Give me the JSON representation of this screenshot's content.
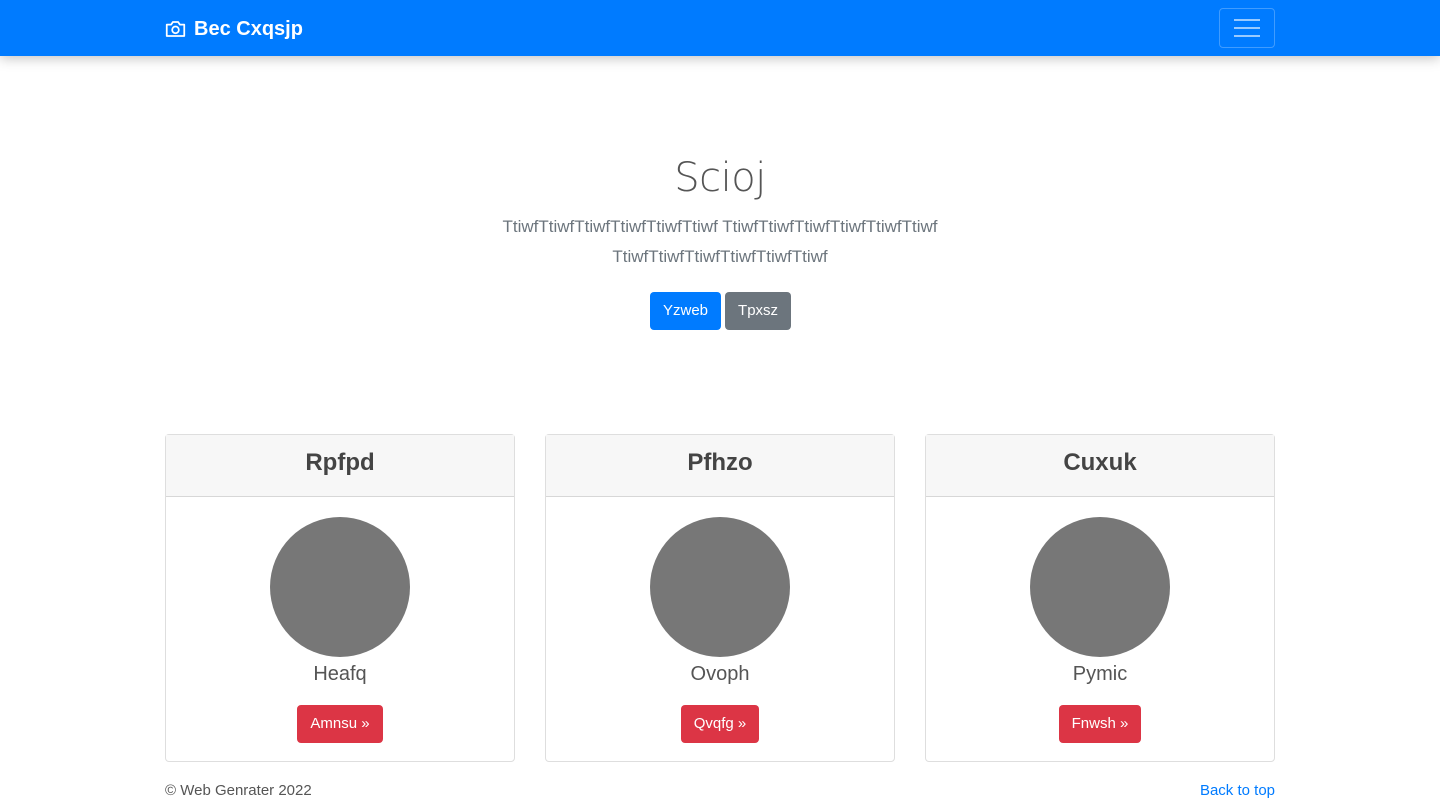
{
  "navbar": {
    "brand_text": "Bec Cxqsjp",
    "brand_icon": "camera-icon",
    "toggler_icon": "hamburger-icon",
    "background": "#007bff"
  },
  "hero": {
    "title": "Scioj",
    "lead": "TtiwfTtiwfTtiwfTtiwfTtiwfTtiwf TtiwfTtiwfTtiwfTtiwfTtiwfTtiwf TtiwfTtiwfTtiwfTtiwfTtiwfTtiwf",
    "primary_button": "Yzweb",
    "secondary_button": "Tpxsz"
  },
  "cards": [
    {
      "header": "Rpfpd",
      "text": "Heafq",
      "button": "Amnsu »"
    },
    {
      "header": "Pfhzo",
      "text": "Ovoph",
      "button": "Qvqfg »"
    },
    {
      "header": "Cuxuk",
      "text": "Pymic",
      "button": "Fnwsh »"
    }
  ],
  "footer": {
    "copyright": "© Web Genrater 2022",
    "back_to_top": "Back to top"
  },
  "colors": {
    "primary": "#007bff",
    "secondary": "#6c757d",
    "danger": "#dc3545",
    "avatar": "#777777"
  }
}
